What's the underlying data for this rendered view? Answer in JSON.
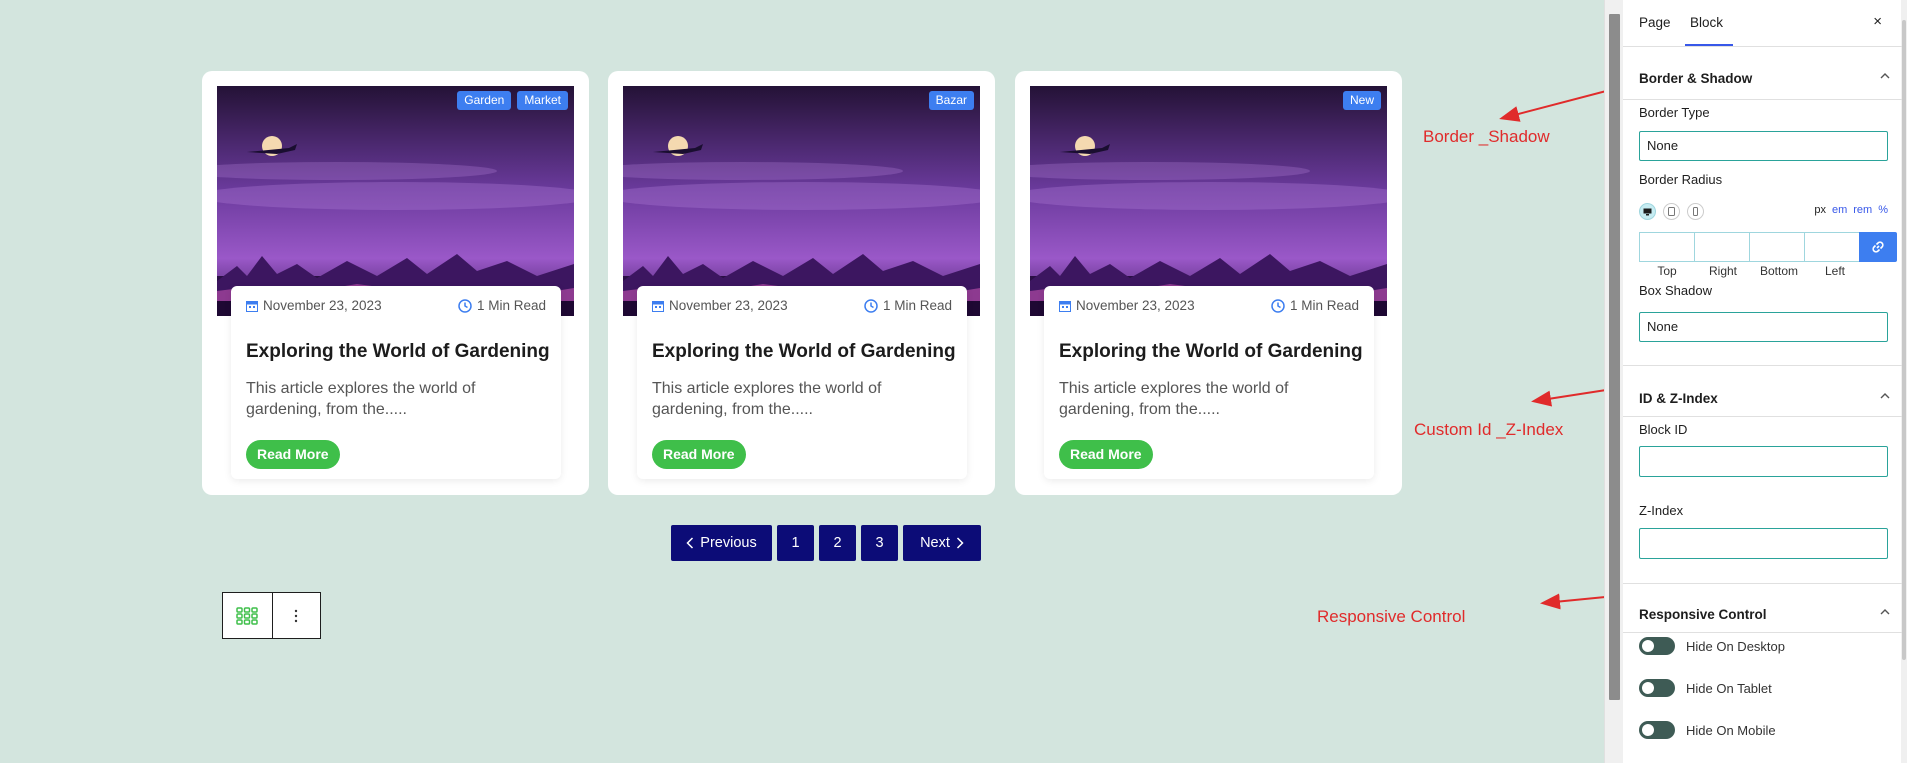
{
  "posts": [
    {
      "tags": [
        "Garden",
        "Market"
      ],
      "date": "November 23, 2023",
      "read_time": "1 Min Read",
      "title": "Exploring the World of Gardening",
      "excerpt": "This article explores the world of gardening, from the.....",
      "button": "Read More"
    },
    {
      "tags": [
        "Bazar"
      ],
      "date": "November 23, 2023",
      "read_time": "1 Min Read",
      "title": "Exploring the World of Gardening",
      "excerpt": "This article explores the world of gardening, from the.....",
      "button": "Read More"
    },
    {
      "tags": [
        "New"
      ],
      "date": "November 23, 2023",
      "read_time": "1 Min Read",
      "title": "Exploring the World of Gardening",
      "excerpt": "This article explores the world of gardening, from the.....",
      "button": "Read More"
    }
  ],
  "pagination": {
    "previous": "Previous",
    "pages": [
      "1",
      "2",
      "3"
    ],
    "next": "Next"
  },
  "annotations": {
    "border_shadow": "Border _Shadow",
    "custom_id": "Custom Id _Z-Index",
    "responsive": "Responsive Control"
  },
  "sidebar": {
    "tabs": [
      "Page",
      "Block"
    ],
    "active_tab": "Block",
    "close": "×",
    "border_shadow": {
      "title": "Border & Shadow",
      "border_type_label": "Border Type",
      "border_type_value": "None",
      "border_radius_label": "Border Radius",
      "units": [
        "px",
        "em",
        "rem",
        "%"
      ],
      "active_unit": "px",
      "radius_labels": [
        "Top",
        "Right",
        "Bottom",
        "Left"
      ],
      "box_shadow_label": "Box Shadow",
      "box_shadow_value": "None"
    },
    "id_zindex": {
      "title": "ID & Z-Index",
      "block_id_label": "Block ID",
      "zindex_label": "Z-Index"
    },
    "responsive": {
      "title": "Responsive Control",
      "toggles": [
        "Hide On Desktop",
        "Hide On Tablet",
        "Hide On Mobile"
      ]
    }
  },
  "colors": {
    "canvas_bg": "#d3e5de",
    "tag_blue": "#3d7ef0",
    "read_more_green": "#3fbf4a",
    "pagination_navy": "#0c0c77",
    "annotation_red": "#e02b2b",
    "input_border_teal": "#2aa39a"
  }
}
